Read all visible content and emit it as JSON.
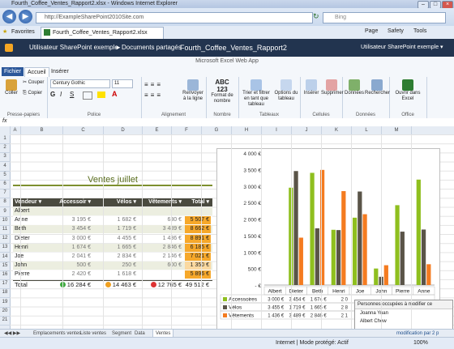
{
  "window": {
    "title": "Fourth_Coffee_Ventes_Rapport2.xlsx - Windows Internet Explorer"
  },
  "browser": {
    "url": "http://ExampleSharePoint2010Site.com",
    "search_placeholder": "Bing",
    "favorites_label": "Favorites",
    "tab_title": "Fourth_Coffee_Ventes_Rapport2.xlsx",
    "page_label": "Page",
    "safety_label": "Safety",
    "tools_label": "Tools"
  },
  "sharepoint": {
    "user_site": "Utilisateur SharePoint exemple",
    "breadcrumb_sep": "►",
    "docs": "Documents partagés",
    "file": "Fourth_Coffee_Ventes_Rapport2",
    "user": "Utilisateur SharePoint exemple ▾"
  },
  "ribbon": {
    "app_title": "Microsoft Excel Web App",
    "tabs": [
      "Fichier",
      "Accueil",
      "Insérer"
    ],
    "clipboard": {
      "paste": "Coller",
      "cut": "Couper",
      "copy": "Copier",
      "label": "Presse-papiers"
    },
    "font": {
      "name": "Century Gothic",
      "size": "11",
      "bold": "G",
      "italic": "I",
      "underline": "S",
      "label": "Police"
    },
    "alignment": {
      "wrap": "Renvoyer à la ligne",
      "label": "Alignement"
    },
    "number": {
      "format": "Format de nombre",
      "label": "Nombre"
    },
    "tables": {
      "sort": "Trier et filtrer en tant que tableau",
      "options": "Options du tableau",
      "label": "Tableaux"
    },
    "cells": {
      "insert": "Insérer",
      "delete": "Supprimer",
      "label": "Cellules"
    },
    "data": {
      "refresh": "Données",
      "find": "Rechercher",
      "label": "Données"
    },
    "office": {
      "open": "Ouvrir dans Excel",
      "label": "Office"
    }
  },
  "formula_bar": {
    "fx": "fx",
    "value": ""
  },
  "columns": [
    "A",
    "B",
    "C",
    "D",
    "E",
    "F",
    "G",
    "H",
    "I",
    "J",
    "K",
    "L",
    "M"
  ],
  "rows": [
    "1",
    "2",
    "3",
    "4",
    "5",
    "6",
    "7",
    "8",
    "9",
    "10",
    "11",
    "12",
    "13",
    "14",
    "15",
    "16",
    "17",
    "18",
    "19",
    "20",
    "21"
  ],
  "table": {
    "title": "Ventes juillet",
    "headers": [
      "Vendeur",
      "Accessoir",
      "Vélos",
      "Vêtements",
      "Total"
    ],
    "group": "Albert",
    "rows": [
      {
        "name": "Anne",
        "acc": "3 195 €",
        "vel": "1 682 €",
        "vet": "630 €",
        "tot": "5 507 €",
        "flag": "orange"
      },
      {
        "name": "Beth",
        "acc": "3 454 €",
        "vel": "1 719 €",
        "vet": "3 489 €",
        "tot": "8 662 €",
        "flag": "orange"
      },
      {
        "name": "Dieter",
        "acc": "3 000 €",
        "vel": "4 455 €",
        "vet": "1 436 €",
        "tot": "8 891 €",
        "flag": "orange"
      },
      {
        "name": "Henri",
        "acc": "1 674 €",
        "vel": "1 665 €",
        "vet": "2 846 €",
        "tot": "6 185 €",
        "flag": "orange"
      },
      {
        "name": "Joe",
        "acc": "2 041 €",
        "vel": "2 834 €",
        "vet": "2 146 €",
        "tot": "7 021 €",
        "flag": "orange"
      },
      {
        "name": "John",
        "acc": "500 €",
        "vel": "250 €",
        "vet": "600 €",
        "tot": "1 350 €",
        "flag": "light"
      },
      {
        "name": "Pierre",
        "acc": "2 420 €",
        "vel": "1 618 €",
        "vet": "",
        "tot": "5 896 €",
        "flag": "orange"
      }
    ],
    "total": {
      "label": "Total",
      "acc": "16 284 €",
      "vel": "14 463 €",
      "vet": "12 765 €",
      "tot": "49 512 €"
    }
  },
  "chart_data": {
    "type": "bar",
    "categories": [
      "Albert",
      "Dieter",
      "Beth",
      "Henri",
      "Joe",
      "John",
      "Pierre",
      "Anne"
    ],
    "series": [
      {
        "name": "Accessoires",
        "color": "#8fbf1f",
        "values": [
          0,
          2950,
          3400,
          1674,
          2041,
          500,
          2420,
          3195
        ]
      },
      {
        "name": "Vélos",
        "color": "#5a5448",
        "values": [
          0,
          3454,
          1719,
          1665,
          2834,
          250,
          1618,
          1682
        ]
      },
      {
        "name": "Vêtements",
        "color": "#f47b20",
        "values": [
          0,
          1436,
          3489,
          2846,
          2146,
          600,
          0,
          630
        ]
      }
    ],
    "ylim": [
      0,
      4000
    ],
    "yticks": [
      "4 000 €",
      "3 500 €",
      "3 000 €",
      "2 500 €",
      "2 000 €",
      "1 500 €",
      "1 000 €",
      "500 €",
      "- €"
    ],
    "table_rows": [
      [
        "3 000 €",
        "3 454 €",
        "1 674 €",
        "2 0"
      ],
      [
        "3 455 €",
        "1 719 €",
        "1 665 €",
        "2 8"
      ],
      [
        "1 436 €",
        "3 489 €",
        "2 846 €",
        "2 1"
      ]
    ],
    "legend_position": "bottom-table"
  },
  "popup": {
    "title": "Personnes occupées à modifier ce",
    "users": [
      "Joanna Yuan",
      "Albert Chew"
    ]
  },
  "sheets": [
    "Emplacements ventes",
    "Liste ventes",
    "Segment",
    "Data",
    "Ventes"
  ],
  "status": {
    "zone": "Internet | Mode protégé: Actif",
    "zoom": "100%",
    "modif": "modification par 2 p"
  }
}
